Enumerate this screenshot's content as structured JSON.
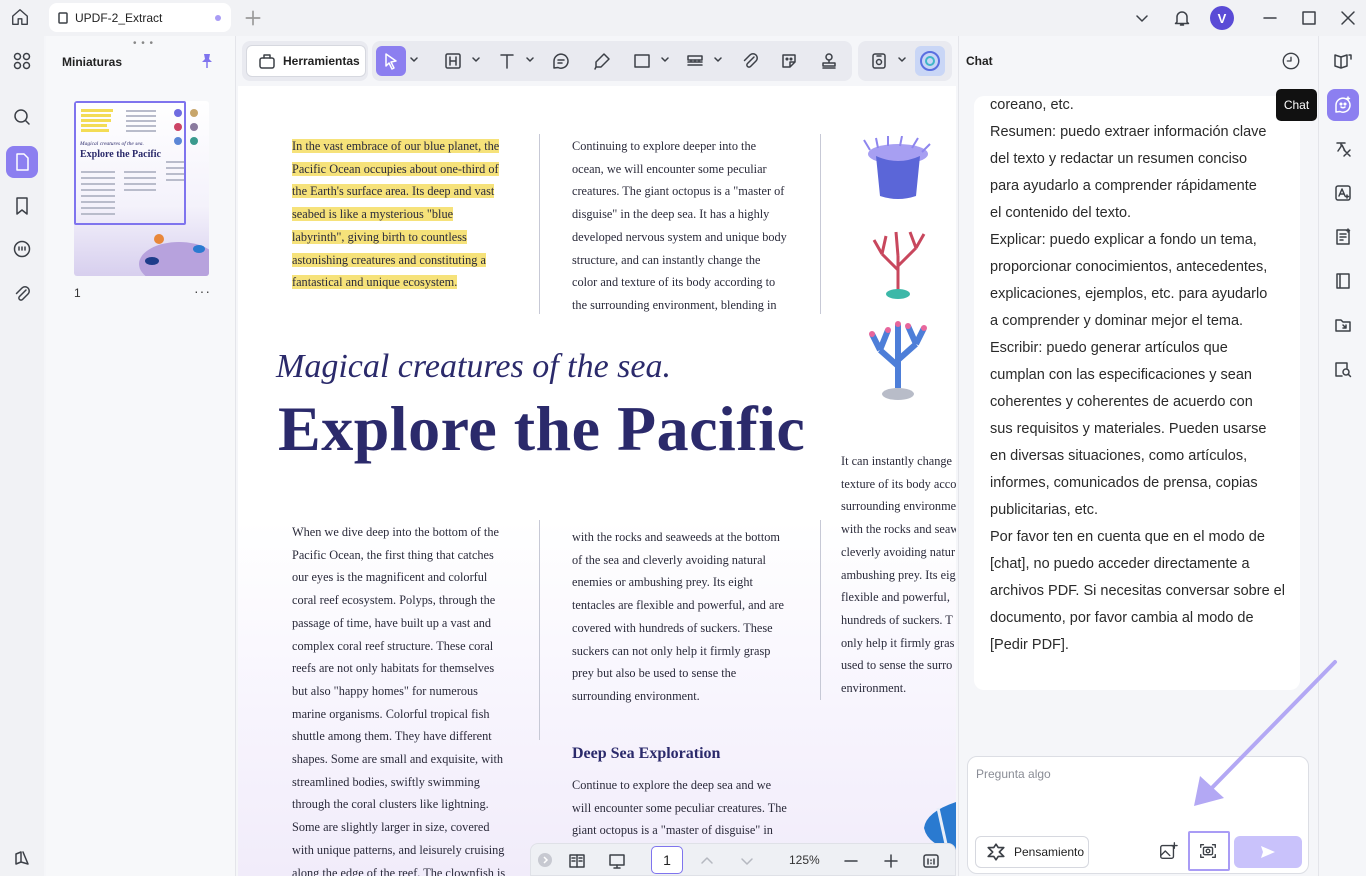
{
  "titlebar": {
    "tab_label": "UPDF-2_Extract",
    "avatar_letter": "V"
  },
  "thumbnails": {
    "title": "Miniaturas",
    "page_number": "1",
    "more": "···",
    "thumb_magical": "Magical creatures of the sea.",
    "thumb_explore": "Explore the Pacific"
  },
  "toolbar": {
    "tools_label": "Herramientas",
    "icons": [
      "select-icon",
      "text-box-icon",
      "text-icon",
      "comment-icon",
      "highlighter-icon",
      "rectangle-icon",
      "stamp-bar-icon",
      "attachment-icon",
      "sticker-icon",
      "signature-icon",
      "screenshot-icon",
      "ai-icon"
    ]
  },
  "document": {
    "col1_top": [
      "In the vast embrace of our blue planet, the",
      "Pacific Ocean occupies about one-third of",
      "the Earth's surface area. Its deep and vast",
      "seabed is like a mysterious \"blue",
      "labyrinth\", giving birth to countless",
      "astonishing creatures and constituting a",
      "fantastical and unique ecosystem."
    ],
    "col2_top": [
      "Continuing to explore deeper into the",
      "ocean, we will encounter some peculiar",
      "creatures. The giant octopus is a \"master of",
      "disguise\" in the deep sea. It has a highly",
      "developed nervous system and unique body",
      "structure, and can instantly change the",
      "color and texture of its body according to",
      "the surrounding environment, blending in"
    ],
    "magical_title": "Magical creatures of the sea.",
    "main_title": "Explore the Pacific",
    "col1_bottom": [
      "When we dive deep into the bottom of the",
      "Pacific Ocean, the first thing that catches",
      "our eyes is the magnificent and colorful",
      "coral reef ecosystem. Polyps, through the",
      "passage of time, have built up a vast and",
      "complex coral reef structure. These coral",
      "reefs are not only habitats for themselves",
      "but also \"happy homes\" for numerous",
      "marine organisms. Colorful tropical fish",
      "shuttle among them. They have different",
      "shapes. Some are small and exquisite, with",
      "streamlined bodies, swiftly swimming",
      "through the coral clusters like lightning.",
      "Some are slightly larger in size, covered",
      "with unique patterns, and leisurely cruising",
      "along the edge of the reef. The clownfish is"
    ],
    "col2_bottom": [
      "with the rocks and seaweeds at the bottom",
      "of the sea and cleverly avoiding natural",
      "enemies or ambushing prey. Its eight",
      "tentacles are flexible and powerful, and are",
      "covered with hundreds of suckers. These",
      "suckers can not only help it firmly grasp",
      "prey but also be used to sense the",
      "surrounding environment."
    ],
    "col3": [
      "It can instantly change",
      "texture of its body acco",
      "surrounding environme",
      "with the rocks and seaw",
      "cleverly avoiding natur",
      "ambushing prey. Its eig",
      "flexible and powerful,",
      "hundreds of suckers. T",
      "only help it firmly gras",
      "used to sense the surro",
      "environment."
    ],
    "section_title": "Deep Sea Exploration",
    "section_text": [
      "Continue to explore the deep sea and we",
      "will encounter some peculiar creatures. The",
      "giant octopus is a \"master of disguise\" in"
    ]
  },
  "pagenav": {
    "page": "1",
    "zoom": "125%"
  },
  "chat": {
    "title": "Chat",
    "tooltip": "Chat",
    "message_lines": [
      "coreano, etc.",
      "Resumen: puedo extraer información clave",
      "del texto y redactar un resumen conciso",
      "para ayudarlo a comprender rápidamente",
      "el contenido del texto.",
      "Explicar: puedo explicar a fondo un tema,",
      "proporcionar conocimientos, antecedentes,",
      "explicaciones, ejemplos, etc. para ayudarlo",
      "a comprender y dominar mejor el tema.",
      "Escribir: puedo generar artículos que",
      "cumplan con las especificaciones y sean",
      "coherentes y coherentes de acuerdo con",
      "sus requisitos y materiales. Pueden usarse",
      "en diversas situaciones, como artículos,",
      "informes, comunicados de prensa, copias",
      "publicitarias, etc.",
      "Por favor ten en cuenta que en el modo de",
      "[chat], no puedo acceder directamente a",
      "archivos PDF. Si necesitas conversar sobre el",
      "documento, por favor cambia al modo de",
      "[Pedir PDF]."
    ],
    "input_placeholder": "Pregunta algo",
    "thinking_label": "Pensamiento"
  },
  "colors": {
    "accent": "#8c7ff0",
    "title_navy": "#2b2a6b",
    "highlight": "#f6e27a"
  }
}
